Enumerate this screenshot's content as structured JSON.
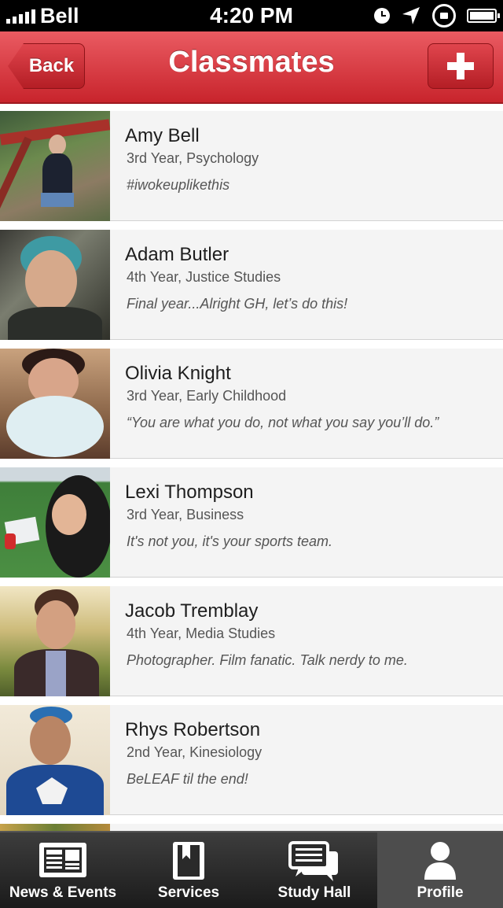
{
  "status_bar": {
    "carrier": "Bell",
    "time": "4:20 PM"
  },
  "nav": {
    "back_label": "Back",
    "title": "Classmates",
    "add_icon": "plus-icon"
  },
  "classmates": [
    {
      "name": "Amy Bell",
      "details": "3rd Year, Psychology",
      "bio": "#iwokeuplikethis"
    },
    {
      "name": "Adam Butler",
      "details": "4th Year, Justice Studies",
      "bio": "Final year...Alright GH, let’s do this!"
    },
    {
      "name": "Olivia Knight",
      "details": "3rd Year, Early Childhood",
      "bio": "“You are what you do, not what you say you’ll do.”"
    },
    {
      "name": "Lexi Thompson",
      "details": "3rd Year, Business",
      "bio": "It's not you, it's your sports team."
    },
    {
      "name": "Jacob Tremblay",
      "details": "4th Year, Media Studies",
      "bio": "Photographer. Film fanatic. Talk nerdy to me."
    },
    {
      "name": "Rhys Robertson",
      "details": "2nd Year, Kinesiology",
      "bio": "BeLEAF til the end!"
    }
  ],
  "tabs": [
    {
      "label": "News & Events",
      "icon": "newspaper-icon"
    },
    {
      "label": "Services",
      "icon": "bookmark-book-icon"
    },
    {
      "label": "Study Hall",
      "icon": "chat-bubbles-icon"
    },
    {
      "label": "Profile",
      "icon": "person-icon",
      "active": true
    }
  ],
  "colors": {
    "nav_red": "#d7343c",
    "tab_bar": "#262626",
    "row_bg": "#f4f4f4"
  }
}
